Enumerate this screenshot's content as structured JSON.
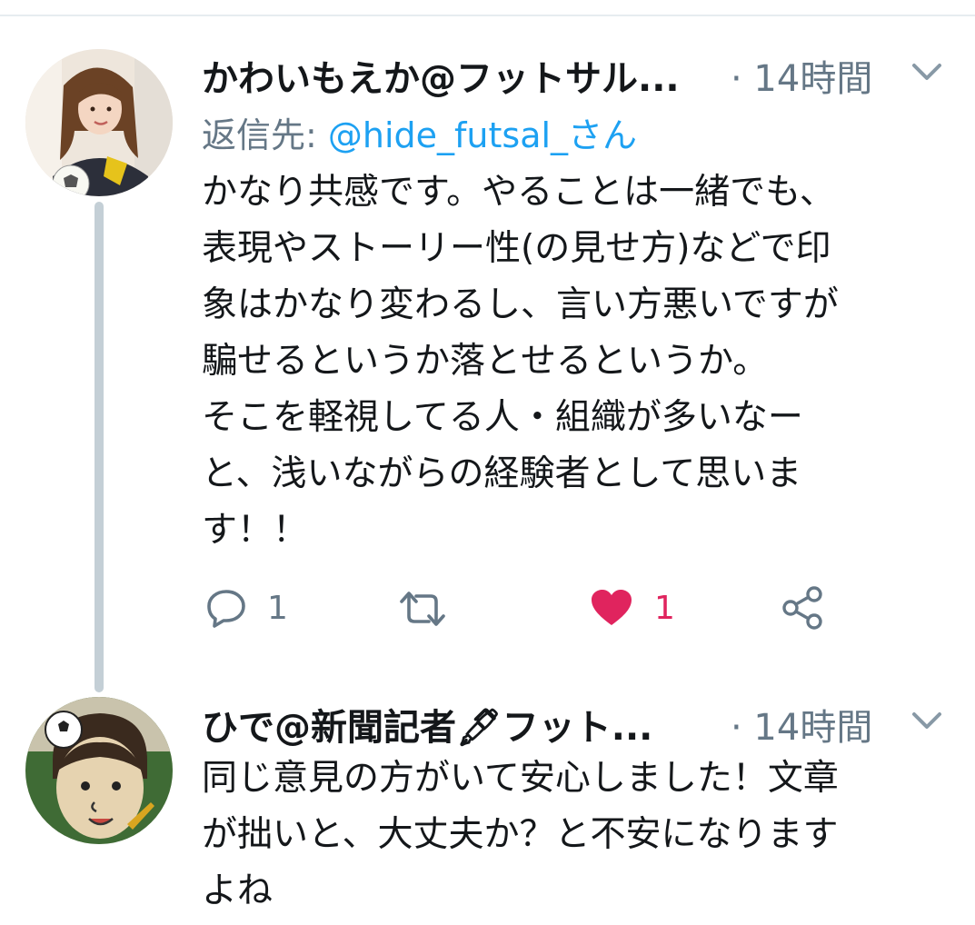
{
  "tweet1": {
    "display_name": "かわいもえか@フットサル...",
    "time": "· 14時間",
    "reply_prefix": "返信先: ",
    "reply_handle": "@hide_futsal_さん",
    "text": "かなり共感です。やることは一緒でも、\n表現やストーリー性(の見せ方)などで印\n象はかなり変わるし、言い方悪いですが\n騙せるというか落とせるというか。\nそこを軽視してる人・組織が多いなー\nと、浅いながらの経験者として思いま\nす！！",
    "reply_count": "1",
    "like_count": "1",
    "like_color": "#e0245e"
  },
  "tweet2": {
    "display_name": "ひで@新聞記者🖋フット...",
    "time": "· 14時間",
    "text": "同じ意見の方がいて安心しました！文章\nが拙いと、大丈夫か？と不安になります\nよね"
  },
  "icons": {
    "menu": "chevron-down-icon",
    "reply": "reply-icon",
    "retweet": "retweet-icon",
    "like": "heart-icon",
    "share": "share-icon"
  },
  "colors": {
    "link": "#1da1f2",
    "secondary": "#657786",
    "thread": "#c4cfd6"
  }
}
